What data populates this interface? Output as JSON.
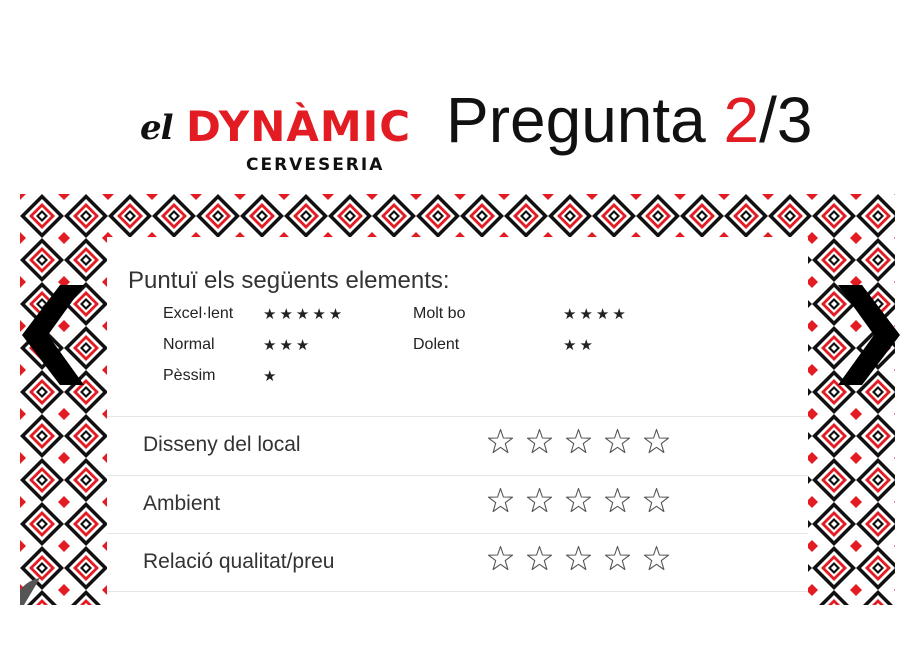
{
  "header": {
    "logo": {
      "brand_prefix": "el",
      "brand_main": "DYNÀMIC",
      "brand_sub": "CERVESERIA"
    },
    "title_prefix": "Pregunta ",
    "current": "2",
    "total_sep": "/3"
  },
  "survey": {
    "instruction": "Puntuï els següents elements:",
    "legend": [
      {
        "label": "Excel·lent",
        "stars": "★★★★★"
      },
      {
        "label": "Molt bo",
        "stars": "★★★★"
      },
      {
        "label": "Normal",
        "stars": "★★★"
      },
      {
        "label": "Dolent",
        "stars": "★★"
      },
      {
        "label": "Pèssim",
        "stars": "★"
      }
    ],
    "rows": [
      {
        "label": "Disseny del local",
        "rating": 0,
        "max": 5
      },
      {
        "label": "Ambient",
        "rating": 0,
        "max": 5
      },
      {
        "label": "Relació qualitat/preu",
        "rating": 0,
        "max": 5
      }
    ]
  },
  "colors": {
    "accent": "#e31b23",
    "pattern_dark": "#111111",
    "text": "#333333"
  },
  "icons": {
    "prev": "chevron-left-icon",
    "next": "chevron-right-icon",
    "empty_star": "star-outline-icon"
  }
}
